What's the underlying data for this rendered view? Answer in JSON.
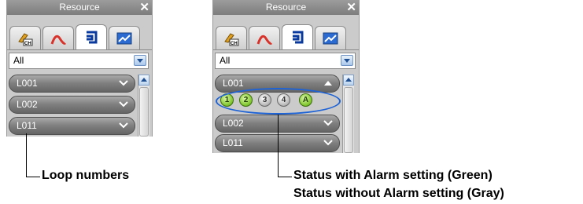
{
  "left_panel": {
    "title": "Resource",
    "close_glyph": "✕",
    "tab_icons": [
      "channel-icon",
      "trend-icon",
      "loop-icon",
      "display-icon"
    ],
    "filter": {
      "value": "All"
    },
    "loops": [
      {
        "label": "L001"
      },
      {
        "label": "L002"
      },
      {
        "label": "L011"
      }
    ]
  },
  "right_panel": {
    "title": "Resource",
    "close_glyph": "✕",
    "tab_icons": [
      "channel-icon",
      "trend-icon",
      "loop-icon",
      "display-icon"
    ],
    "filter": {
      "value": "All"
    },
    "loops": [
      {
        "label": "L001",
        "expanded": true
      },
      {
        "label": "L002"
      },
      {
        "label": "L011"
      }
    ],
    "statuses": [
      {
        "label": "1",
        "color": "#7dc42a",
        "state": "green"
      },
      {
        "label": "2",
        "color": "#7dc42a",
        "state": "green"
      },
      {
        "label": "3",
        "color": "#b5b5b5",
        "state": "gray"
      },
      {
        "label": "4",
        "color": "#b5b5b5",
        "state": "gray"
      },
      {
        "label": "A",
        "color": "#7dc42a",
        "state": "green"
      }
    ]
  },
  "annotations": {
    "loop_numbers": "Loop numbers",
    "status_green": "Status with Alarm setting (Green)",
    "status_gray": "Status without Alarm setting (Gray)"
  },
  "colors": {
    "highlight_ellipse": "#1e63d6"
  }
}
